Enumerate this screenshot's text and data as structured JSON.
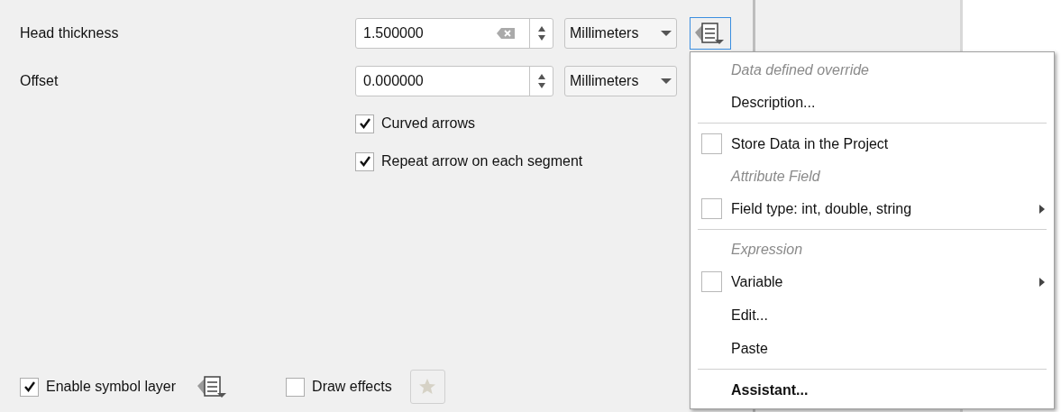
{
  "fields": [
    {
      "label": "Head thickness",
      "value": "1.500000",
      "clearable": true,
      "unit": "Millimeters",
      "override": true
    },
    {
      "label": "Offset",
      "value": "0.000000",
      "clearable": false,
      "unit": "Millimeters",
      "override": false
    }
  ],
  "options": [
    {
      "label": "Curved arrows",
      "checked": true
    },
    {
      "label": "Repeat arrow on each segment",
      "checked": true
    }
  ],
  "footer": {
    "enable": {
      "label": "Enable symbol layer",
      "checked": true
    },
    "effects": {
      "label": "Draw effects",
      "checked": false
    }
  },
  "menu": [
    {
      "kind": "header",
      "label": "Data defined override"
    },
    {
      "kind": "action",
      "label": "Description..."
    },
    {
      "kind": "separator"
    },
    {
      "kind": "check",
      "label": "Store Data in the Project",
      "checked": false,
      "submenu": false
    },
    {
      "kind": "header",
      "label": "Attribute Field"
    },
    {
      "kind": "check",
      "label": "Field type: int, double, string",
      "checked": false,
      "submenu": true
    },
    {
      "kind": "separator"
    },
    {
      "kind": "header",
      "label": "Expression"
    },
    {
      "kind": "check",
      "label": "Variable",
      "checked": false,
      "submenu": true
    },
    {
      "kind": "action",
      "label": "Edit..."
    },
    {
      "kind": "action",
      "label": "Paste"
    },
    {
      "kind": "separator"
    },
    {
      "kind": "bold",
      "label": "Assistant..."
    }
  ]
}
